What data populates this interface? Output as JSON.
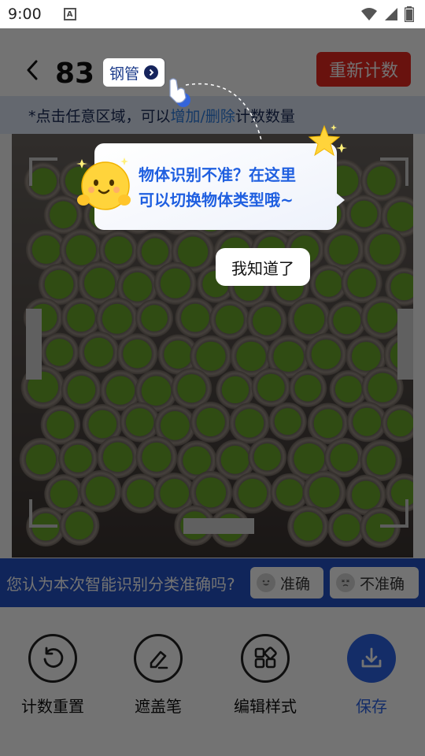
{
  "status_bar": {
    "time": "9:00",
    "icons": [
      "notification-a-icon",
      "wifi-icon",
      "signal-icon",
      "battery-icon"
    ]
  },
  "header": {
    "count": "83",
    "object_type": "钢管",
    "recount_label": "重新计数"
  },
  "hint": {
    "prefix": "*点击任意区域，可以",
    "highlight": "增加/删除",
    "suffix": "计数数量"
  },
  "feedback": {
    "question": "您认为本次智能识别分类准确吗?",
    "accurate_label": "准确",
    "inaccurate_label": "不准确"
  },
  "toolbar": {
    "items": [
      {
        "label": "计数重置",
        "icon": "reset-icon"
      },
      {
        "label": "遮盖笔",
        "icon": "eraser-pen-icon"
      },
      {
        "label": "编辑样式",
        "icon": "edit-style-icon"
      },
      {
        "label": "保存",
        "icon": "download-save-icon"
      }
    ]
  },
  "guide": {
    "line1": "物体识别不准？在这里",
    "line2": "可以切换物体类型哦~",
    "confirm_label": "我知道了"
  },
  "colors": {
    "accent": "#2e64e6",
    "danger": "#e8281f",
    "marker": "#6aa82a",
    "feedback_bar": "#2452c8",
    "hint_bg": "#dde6f7"
  }
}
